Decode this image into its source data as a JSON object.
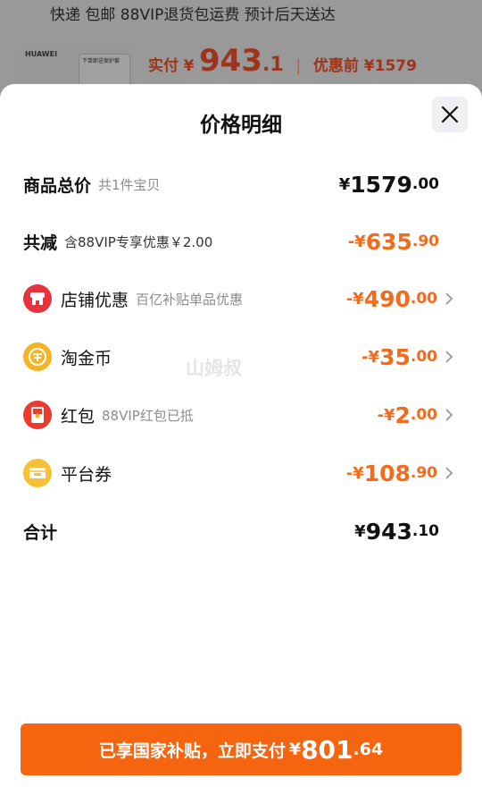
{
  "background": {
    "shipping": "快递 包邮 88VIP退货包运费 预计后天送达",
    "product_brand": "HUAWEI",
    "product_box_text": "下单即送保护套",
    "actual_label": "实付",
    "actual_currency": "¥",
    "actual_int": "943",
    "actual_dec": ".1",
    "separator": "|",
    "original_label": "优惠前 ¥1579"
  },
  "sheet": {
    "title": "价格明细",
    "watermark": "山姆叔",
    "rows": [
      {
        "label": "商品总价",
        "sub": "共1件宝贝",
        "currency": "¥",
        "int": "1579",
        "dec": ".00"
      },
      {
        "label": "共减",
        "sub": "含88VIP专享优惠￥2.00",
        "currency": "-¥",
        "int": "635",
        "dec": ".90"
      },
      {
        "label": "店铺优惠",
        "sub": "百亿补贴单品优惠",
        "currency": "-¥",
        "int": "490",
        "dec": ".00",
        "icon": "store-icon"
      },
      {
        "label": "淘金币",
        "sub": "",
        "currency": "-¥",
        "int": "35",
        "dec": ".00",
        "icon": "coin-icon"
      },
      {
        "label": "红包",
        "sub": "88VIP红包已抵",
        "currency": "-¥",
        "int": "2",
        "dec": ".00",
        "icon": "red-packet-icon"
      },
      {
        "label": "平台券",
        "sub": "",
        "currency": "-¥",
        "int": "108",
        "dec": ".90",
        "icon": "coupon-icon"
      },
      {
        "label": "合计",
        "sub": "",
        "currency": "¥",
        "int": "943",
        "dec": ".10"
      }
    ]
  },
  "pay_button": {
    "text": "已享国家补贴，立即支付",
    "currency": "¥",
    "int": "801",
    "dec": ".64"
  },
  "colors": {
    "accent": "#f5640f",
    "discount": "#f36b1c",
    "store_icon": "#e8323c",
    "coin_icon": "#f6b323",
    "red_packet_icon": "#ec3a2e",
    "coupon_icon": "#f7c137"
  }
}
